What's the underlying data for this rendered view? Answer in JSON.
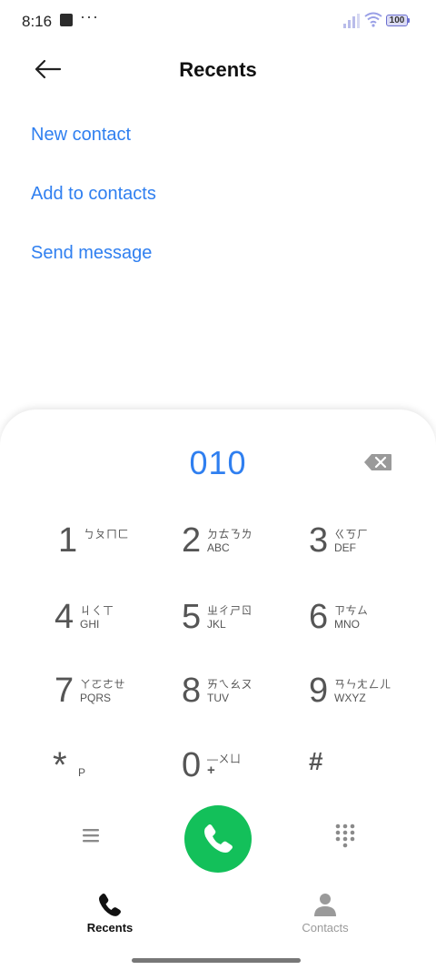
{
  "status_bar": {
    "time": "8:16",
    "dots": "···",
    "battery": "100"
  },
  "header": {
    "title": "Recents"
  },
  "options": [
    "New contact",
    "Add to contacts",
    "Send message"
  ],
  "dialer": {
    "number": "010",
    "keys": [
      {
        "digit": "1",
        "zhuyin": "ㄅㄆㄇㄈ",
        "letters": ""
      },
      {
        "digit": "2",
        "zhuyin": "ㄉㄊㄋㄌ",
        "letters": "ABC"
      },
      {
        "digit": "3",
        "zhuyin": "ㄍㄎㄏ",
        "letters": "DEF"
      },
      {
        "digit": "4",
        "zhuyin": "ㄐㄑㄒ",
        "letters": "GHI"
      },
      {
        "digit": "5",
        "zhuyin": "ㄓㄔㄕㄖ",
        "letters": "JKL"
      },
      {
        "digit": "6",
        "zhuyin": "ㄗㄘㄙ",
        "letters": "MNO"
      },
      {
        "digit": "7",
        "zhuyin": "ㄚㄛㄜㄝ",
        "letters": "PQRS"
      },
      {
        "digit": "8",
        "zhuyin": "ㄞㄟㄠㄡ",
        "letters": "TUV"
      },
      {
        "digit": "9",
        "zhuyin": "ㄢㄣㄤㄥㄦ",
        "letters": "WXYZ"
      },
      {
        "digit": "*",
        "zhuyin": "",
        "letters": "P"
      },
      {
        "digit": "0",
        "zhuyin": "—ㄨㄩ",
        "letters": "+"
      },
      {
        "digit": "#",
        "zhuyin": "",
        "letters": ""
      }
    ]
  },
  "bottom_nav": [
    {
      "label": "Recents",
      "active": true
    },
    {
      "label": "Contacts",
      "active": false
    }
  ],
  "colors": {
    "accent": "#2f7ff0",
    "call": "#13c05a",
    "inactive": "#9a9a9a"
  },
  "icons": [
    "back-arrow-icon",
    "signal-icon",
    "wifi-icon",
    "backspace-icon",
    "menu-icon",
    "phone-icon",
    "dialpad-icon",
    "person-icon"
  ]
}
